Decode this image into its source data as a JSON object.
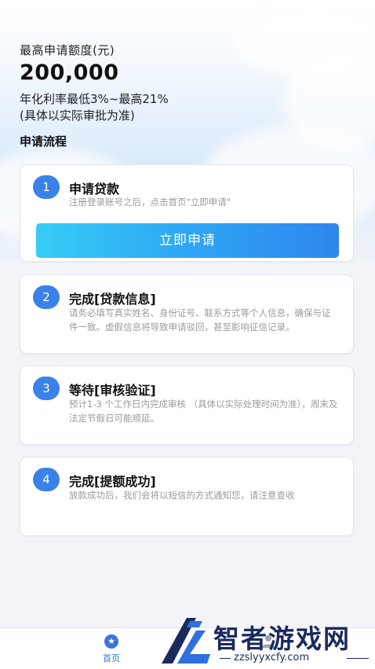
{
  "hero": {
    "quota_label": "最高申请额度(元)",
    "quota_amount": "200,000",
    "rate_range": "年化利率最低3%~最高21%",
    "rate_note": "(具体以实际审批为准)"
  },
  "process": {
    "title": "申请流程",
    "steps": [
      {
        "number": "1",
        "title": "申请贷款",
        "desc": "注册登录账号之后，点击首页\"立即申请\"",
        "button_label": "立即申请"
      },
      {
        "number": "2",
        "title": "完成[贷款信息]",
        "desc": "请务必填写真实姓名、身份证号、联系方式等个人信息，确保与证件一致。虚假信息将导致申请驳回，甚至影响征信记录。"
      },
      {
        "number": "3",
        "title": "等待[审核验证]",
        "desc": "预计1-3 个工作日内完成审核 （具体以实际处理时间为准），周末及法定节假日可能顺延。"
      },
      {
        "number": "4",
        "title": "完成[提额成功]",
        "desc": "放款成功后，我们会将以短信的方式通知您，请注意查收"
      }
    ]
  },
  "tabbar": {
    "home_label": "首页",
    "home_icon": "star-icon",
    "mine_icon": "user-icon"
  },
  "watermark": {
    "name": "智者游戏网",
    "url": "zzslyyxcfy.com"
  },
  "colors": {
    "accent": "#3b82e8",
    "button_start": "#36cdf7",
    "button_end": "#2d86ee",
    "watermark": "#1b2a5e"
  }
}
